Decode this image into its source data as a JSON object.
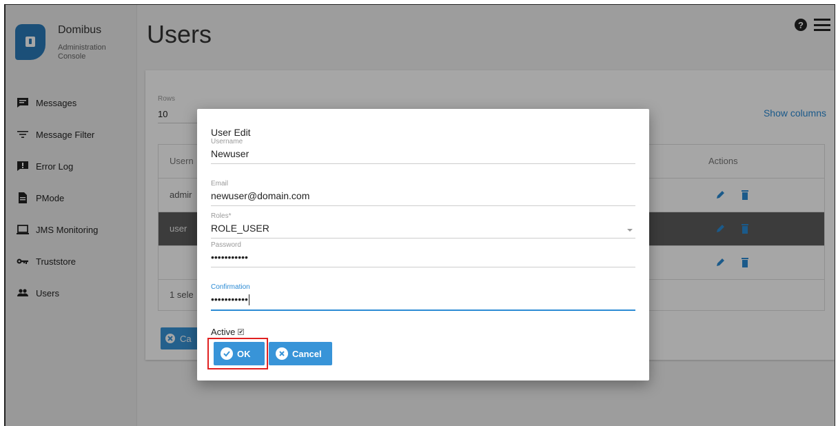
{
  "brand": {
    "title": "Domibus",
    "subtitle": "Administration Console"
  },
  "sidebar": {
    "items": [
      {
        "label": "Messages",
        "icon": "message-icon"
      },
      {
        "label": "Message Filter",
        "icon": "filter-icon"
      },
      {
        "label": "Error Log",
        "icon": "error-log-icon"
      },
      {
        "label": "PMode",
        "icon": "document-icon"
      },
      {
        "label": "JMS Monitoring",
        "icon": "monitor-icon"
      },
      {
        "label": "Truststore",
        "icon": "key-icon"
      },
      {
        "label": "Users",
        "icon": "users-icon"
      }
    ]
  },
  "header": {
    "title": "Users"
  },
  "table": {
    "rows_label": "Rows",
    "rows_value": "10",
    "show_columns": "Show columns",
    "col_username_partial": "Usern",
    "col_actions": "Actions",
    "rows": [
      {
        "username_partial": "admir"
      },
      {
        "username_partial": "user"
      },
      {
        "username_partial": ""
      }
    ],
    "footer_partial": "1 sele",
    "bottom_button_partial": "Ca"
  },
  "dialog": {
    "title": "User Edit",
    "username_label": "Username",
    "username_value": "Newuser",
    "email_label": "Email",
    "email_value": "newuser@domain.com",
    "roles_label": "Roles*",
    "roles_value": "ROLE_USER",
    "password_label": "Password",
    "password_value": "•••••••••••",
    "confirmation_label": "Confirmation",
    "confirmation_value": "•••••••••••",
    "active_label": "Active",
    "active_checked": true,
    "ok_label": "OK",
    "cancel_label": "Cancel"
  },
  "colors": {
    "accent": "#3894d8",
    "link": "#2a8ad4",
    "highlight": "#e02020",
    "selected_row": "#5c5c5c"
  }
}
